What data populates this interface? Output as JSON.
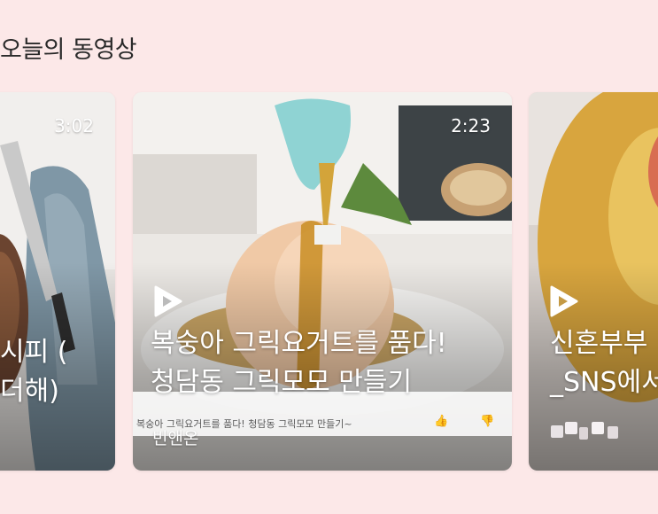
{
  "section": {
    "title": "오늘의 동영상"
  },
  "cards": [
    {
      "duration": "3:02",
      "title_lines": [
        "시피 (",
        "더해)"
      ]
    },
    {
      "duration": "2:23",
      "title_lines": [
        "복숭아 그릭요거트를 품다!",
        "청담동 그릭모모 만들기"
      ],
      "channel": "빈앤온",
      "embedded_caption": "복숭아 그릭요거트를 품다! 청담동 그릭모모 만들기~"
    },
    {
      "title_lines": [
        "신혼부부",
        "_SNS에서"
      ]
    }
  ],
  "colors": {
    "background": "#fce8e8",
    "text_on_media": "#ffffff"
  },
  "icons": {
    "play": "play-triangle-icon",
    "like": "thumbs-up-icon",
    "dislike": "thumbs-down-icon"
  }
}
